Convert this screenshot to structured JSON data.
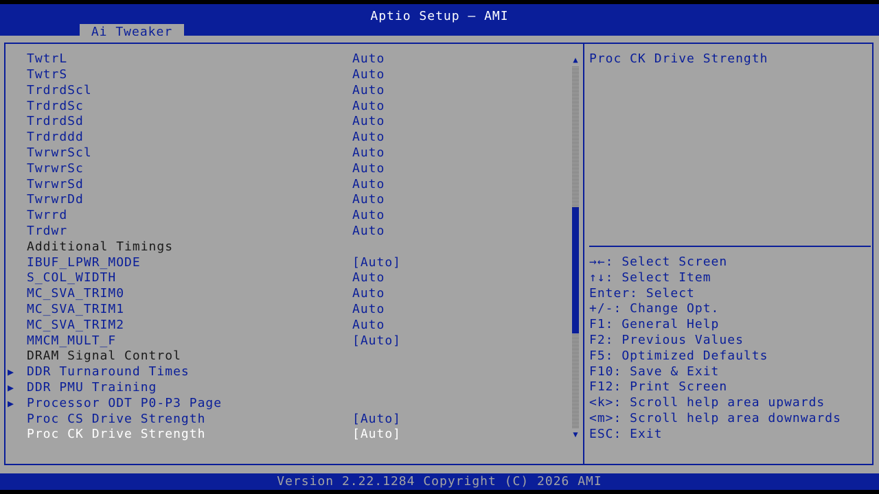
{
  "window": {
    "title": "Aptio Setup – AMI"
  },
  "tabs": [
    {
      "label": "Ai Tweaker",
      "active": true
    }
  ],
  "rows": [
    {
      "label": "TwtrL",
      "value": "Auto"
    },
    {
      "label": "TwtrS",
      "value": "Auto"
    },
    {
      "label": "TrdrdScl",
      "value": "Auto"
    },
    {
      "label": "TrdrdSc",
      "value": "Auto"
    },
    {
      "label": "TrdrdSd",
      "value": "Auto"
    },
    {
      "label": "Trdrddd",
      "value": "Auto"
    },
    {
      "label": "TwrwrScl",
      "value": "Auto"
    },
    {
      "label": "TwrwrSc",
      "value": "Auto"
    },
    {
      "label": "TwrwrSd",
      "value": "Auto"
    },
    {
      "label": "TwrwrDd",
      "value": "Auto"
    },
    {
      "label": "Twrrd",
      "value": "Auto"
    },
    {
      "label": "Trdwr",
      "value": "Auto"
    },
    {
      "label": "Additional Timings",
      "value": ""
    },
    {
      "label": "IBUF_LPWR_MODE",
      "value": "[Auto]"
    },
    {
      "label": "S_COL_WIDTH",
      "value": "Auto"
    },
    {
      "label": "MC_SVA_TRIM0",
      "value": "Auto"
    },
    {
      "label": "MC_SVA_TRIM1",
      "value": "Auto"
    },
    {
      "label": "MC_SVA_TRIM2",
      "value": "Auto"
    },
    {
      "label": "MMCM_MULT_F",
      "value": "[Auto]"
    },
    {
      "label": "DRAM Signal Control",
      "value": ""
    },
    {
      "label": "DDR Turnaround Times",
      "value": ""
    },
    {
      "label": "DDR PMU Training",
      "value": ""
    },
    {
      "label": "Processor ODT P0-P3 Page",
      "value": ""
    },
    {
      "label": "Proc CS Drive Strength",
      "value": "[Auto]"
    },
    {
      "label": "Proc CK Drive Strength",
      "value": "[Auto]"
    }
  ],
  "submenu_arrow": "▶",
  "scrollbar": {
    "up_arrow": "▲",
    "down_arrow": "▼"
  },
  "help": {
    "text": "Proc CK Drive Strength",
    "keys": [
      "→←: Select Screen",
      "↑↓: Select Item",
      "Enter: Select",
      "+/-: Change Opt.",
      "F1: General Help",
      "F2: Previous Values",
      "F5: Optimized Defaults",
      "F10: Save & Exit",
      "F12: Print Screen",
      "<k>: Scroll help area upwards",
      "<m>: Scroll help area downwards",
      "ESC: Exit"
    ]
  },
  "footer": {
    "text": "Version 2.22.1284 Copyright (C) 2026 AMI"
  },
  "colors": {
    "accent_blue": "#0a1e99",
    "panel_gray": "#a4a4a4",
    "selected_text": "#ffffff",
    "header_text": "#1a1a1a"
  }
}
